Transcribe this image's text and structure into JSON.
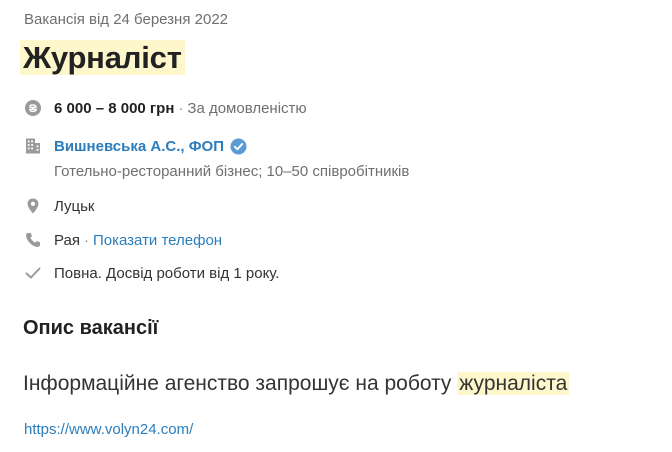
{
  "posted_date": "Вакансія від 24 березня 2022",
  "title": "Журналіст",
  "salary": {
    "amount": "6 000 – 8 000 грн",
    "separator": "·",
    "note": "За домовленістю"
  },
  "company": {
    "name": "Вишневська А.С., ФОП",
    "details": "Готельно-ресторанний бізнес; 10–50 співробітників"
  },
  "location": "Луцьк",
  "contact": {
    "name": "Рая",
    "separator": "·",
    "show_phone": "Показати телефон"
  },
  "requirements": "Повна. Досвід роботи від 1 року.",
  "description": {
    "heading": "Опис вакансії",
    "text_before": "Інформаційне агенство запрошує на роботу ",
    "text_highlight": "журналіста",
    "link": "https://www.volyn24.com/"
  },
  "icons": {
    "salary": "hryvnia-coin-icon",
    "company": "building-icon",
    "verified": "verified-check-icon",
    "location": "map-pin-icon",
    "contact": "phone-icon",
    "requirements": "checkmark-icon"
  },
  "colors": {
    "link": "#2b7dbc",
    "highlight": "#fff7cc",
    "icon": "#9a9a9a",
    "verified": "#5b9bd5"
  }
}
